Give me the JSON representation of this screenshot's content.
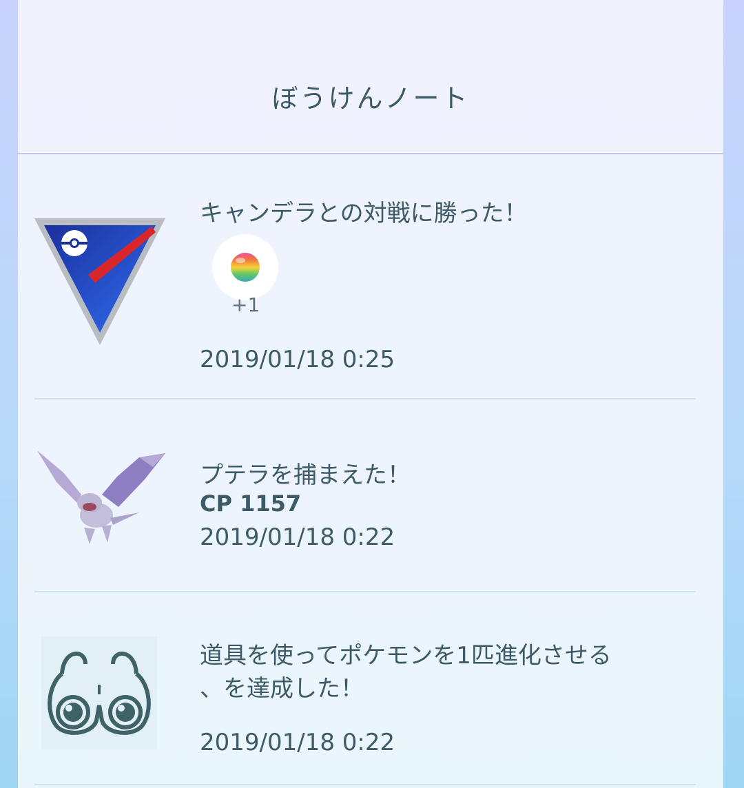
{
  "header": {
    "title": "ぼうけんノート"
  },
  "entries": [
    {
      "icon": "great-league-icon",
      "text": "キャンデラとの対戦に勝った！",
      "reward": {
        "icon": "rare-candy-icon",
        "count": "+1"
      },
      "date": "2019/01/18 0:25"
    },
    {
      "icon": "aerodactyl-icon",
      "text": "プテラを捕まえた！",
      "cp": "CP 1157",
      "date": "2019/01/18 0:22"
    },
    {
      "icon": "binoculars-icon",
      "text_line1": "道具を使ってポケモンを1匹進化させる",
      "text_line2": "、を達成した！",
      "date": "2019/01/18 0:22"
    }
  ]
}
